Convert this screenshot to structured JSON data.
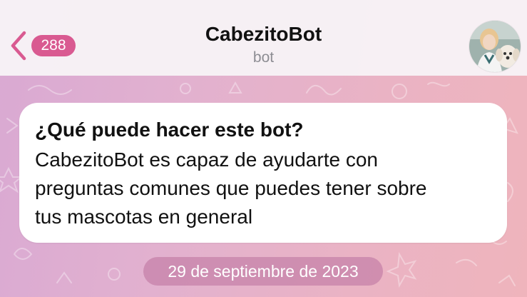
{
  "header": {
    "back_badge": "288",
    "title": "CabezitoBot",
    "subtitle": "bot"
  },
  "avatar": {
    "icon": "bot-avatar-photo"
  },
  "message": {
    "title": "¿Qué puede hacer este bot?",
    "body_lines": [
      "CabezitoBot es capaz de ayudarte con",
      "preguntas comunes que puedes tener sobre",
      "tus mascotas en general"
    ]
  },
  "date_pill": "29 de septiembre de 2023",
  "colors": {
    "accent": "#d95a91",
    "header_bg": "#f7f2f6",
    "wallpaper_start": "#d9a9d3",
    "wallpaper_end": "#efb4bc"
  }
}
